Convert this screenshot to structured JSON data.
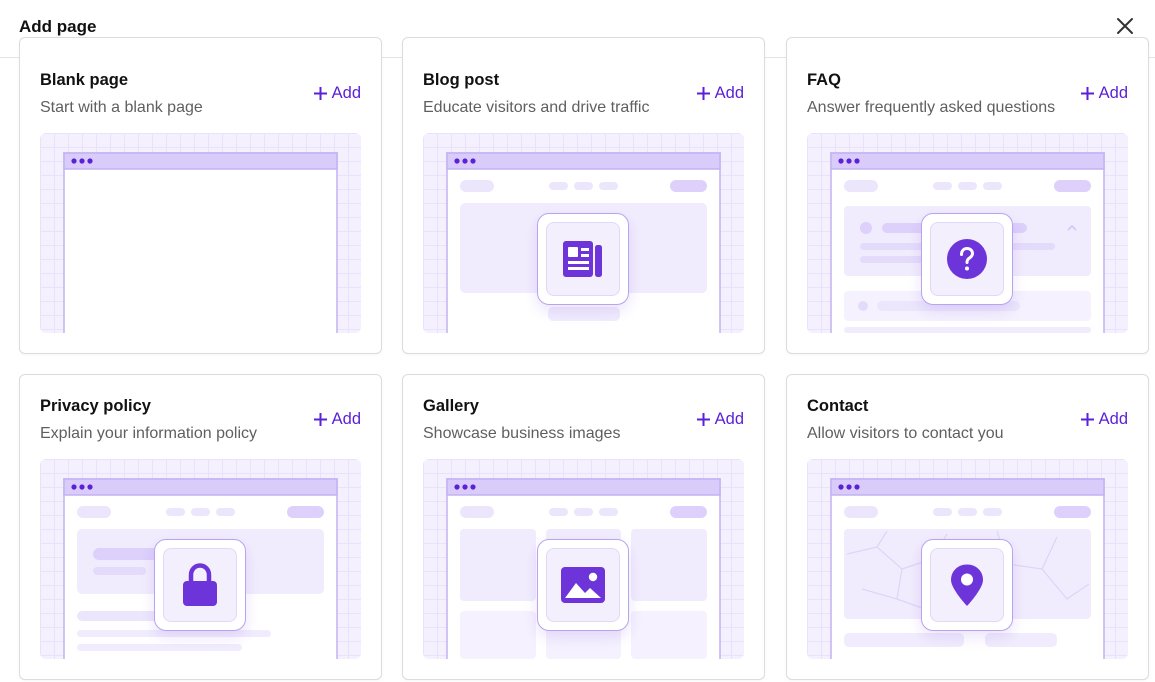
{
  "header": {
    "title": "Add page",
    "close_icon": "close-icon"
  },
  "colors": {
    "accent": "#5b21d6",
    "icon_fill": "#6d35d9",
    "preview_bg": "#f4f0fd"
  },
  "cards": [
    {
      "title": "Blank page",
      "subtitle": "Start with a blank page",
      "add_label": "Add",
      "icon": "none"
    },
    {
      "title": "Blog post",
      "subtitle": "Educate visitors and drive traffic",
      "add_label": "Add",
      "icon": "newspaper-icon"
    },
    {
      "title": "FAQ",
      "subtitle": "Answer frequently asked questions",
      "add_label": "Add",
      "icon": "question-circle-icon"
    },
    {
      "title": "Privacy policy",
      "subtitle": "Explain your information policy",
      "add_label": "Add",
      "icon": "lock-icon"
    },
    {
      "title": "Gallery",
      "subtitle": "Showcase business images",
      "add_label": "Add",
      "icon": "image-icon"
    },
    {
      "title": "Contact",
      "subtitle": "Allow visitors to contact you",
      "add_label": "Add",
      "icon": "map-pin-icon"
    }
  ]
}
